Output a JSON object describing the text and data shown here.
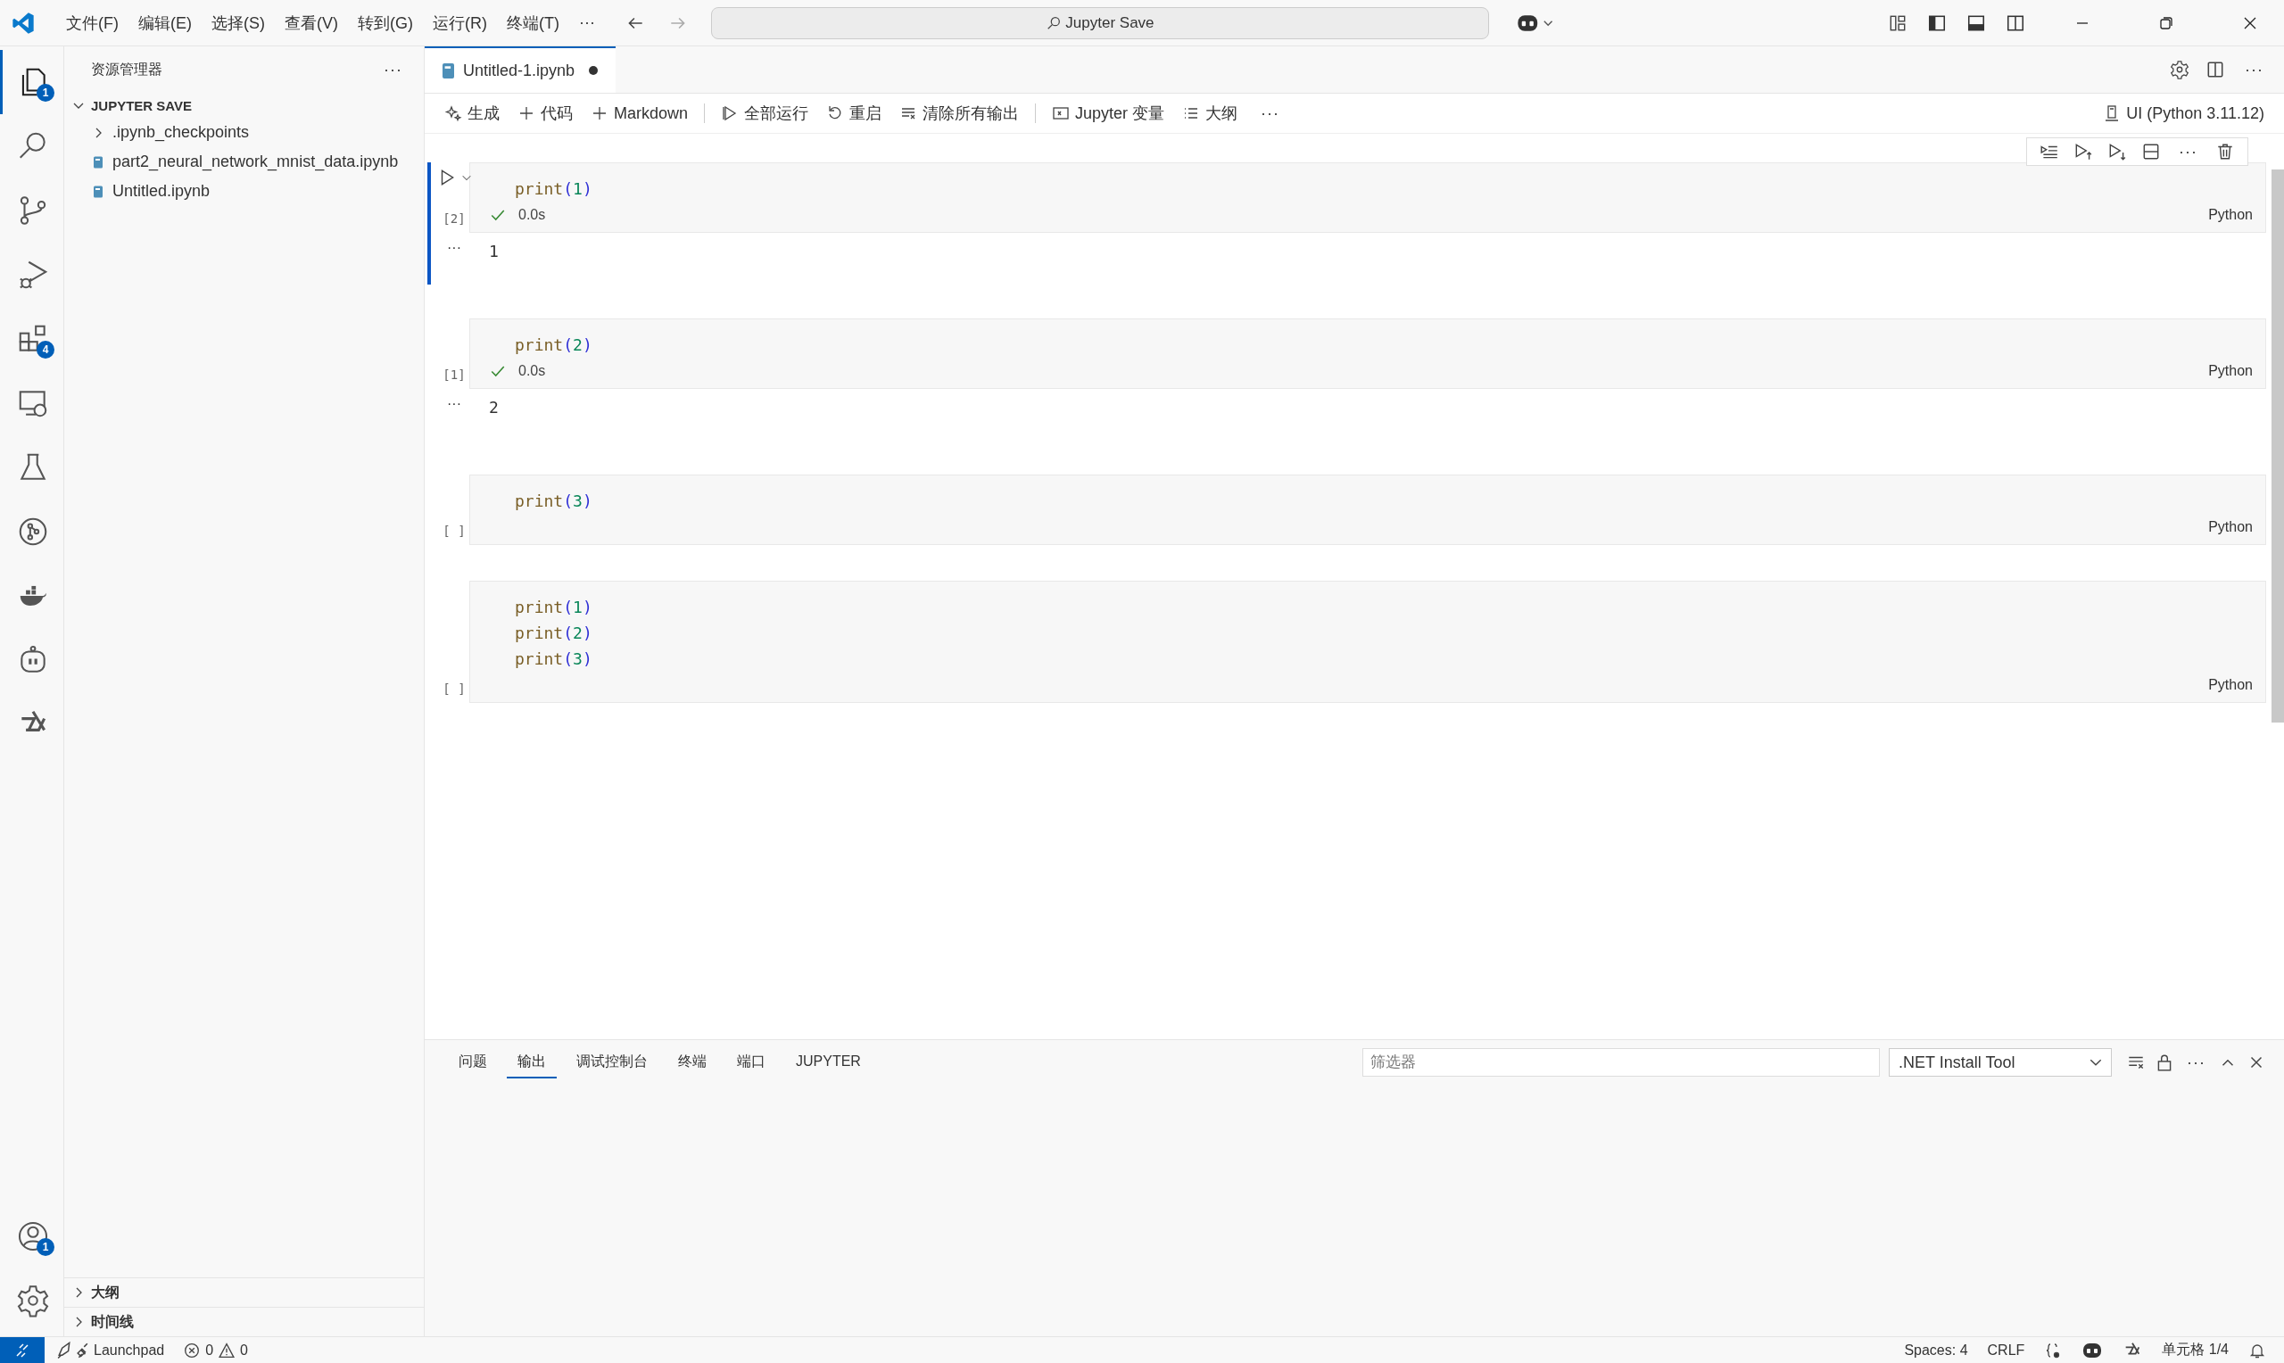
{
  "title_bar": {
    "menus": [
      "文件(F)",
      "编辑(E)",
      "选择(S)",
      "查看(V)",
      "转到(G)",
      "运行(R)",
      "终端(T)"
    ],
    "more": "···",
    "search": "Jupyter Save"
  },
  "activity_bar": {
    "top": [
      {
        "kind": "explorer",
        "selected": true,
        "badge": "1"
      },
      {
        "kind": "search",
        "selected": false
      },
      {
        "kind": "source-control",
        "selected": false
      },
      {
        "kind": "run-debug",
        "selected": false
      },
      {
        "kind": "extensions",
        "selected": false,
        "badge": "4"
      },
      {
        "kind": "remote",
        "selected": false
      },
      {
        "kind": "flask",
        "selected": false
      },
      {
        "kind": "git-graph",
        "selected": false
      },
      {
        "kind": "whale",
        "selected": false
      },
      {
        "kind": "robot",
        "selected": false
      },
      {
        "kind": "knot",
        "selected": false
      }
    ],
    "bottom": [
      {
        "kind": "account",
        "selected": false,
        "badge": "1"
      },
      {
        "kind": "gear",
        "selected": false
      }
    ]
  },
  "sidebar": {
    "title": "资源管理器",
    "more": "···",
    "folder": {
      "name": "JUPYTER SAVE",
      "expanded": true
    },
    "items": [
      {
        "name": ".ipynb_checkpoints",
        "kind": "folder",
        "expanded": false
      },
      {
        "name": "part2_neural_network_mnist_data.ipynb",
        "kind": "notebook"
      },
      {
        "name": "Untitled.ipynb",
        "kind": "notebook"
      }
    ],
    "sections": [
      {
        "name": "大纲",
        "expanded": false
      },
      {
        "name": "时间线",
        "expanded": false
      }
    ]
  },
  "editor_tab": {
    "title": "Untitled-1.ipynb",
    "dirty": true,
    "selected": true
  },
  "toolbar": {
    "groups": [
      [
        {
          "label": "生成",
          "kind": "sparkle"
        },
        {
          "label": "代码",
          "kind": "plus"
        },
        {
          "label": "Markdown",
          "kind": "plus"
        }
      ],
      [
        {
          "label": "全部运行",
          "kind": "run"
        },
        {
          "label": "重启",
          "kind": "restart"
        },
        {
          "label": "清除所有输出",
          "kind": "clear"
        }
      ],
      [
        {
          "label": "Jupyter 变量",
          "kind": "variables"
        },
        {
          "label": "大纲",
          "kind": "list"
        }
      ]
    ],
    "more": "···",
    "kernel": "UI (Python 3.11.12)"
  },
  "cells": [
    {
      "count": "[2]",
      "selected": true,
      "lines": [
        [
          {
            "text": "print",
            "kind": "function"
          },
          {
            "text": "(",
            "kind": "paren"
          },
          {
            "text": "1",
            "kind": "number"
          },
          {
            "text": ")",
            "kind": "paren"
          }
        ]
      ],
      "status": {
        "kind": "success",
        "time": "0.0s"
      },
      "output": "1",
      "output_more": "···",
      "language": "Python"
    },
    {
      "count": "[1]",
      "selected": false,
      "lines": [
        [
          {
            "text": "print",
            "kind": "function"
          },
          {
            "text": "(",
            "kind": "paren"
          },
          {
            "text": "2",
            "kind": "number"
          },
          {
            "text": ")",
            "kind": "paren"
          }
        ]
      ],
      "status": {
        "kind": "success",
        "time": "0.0s"
      },
      "output": "2",
      "output_more": "···",
      "language": "Python"
    },
    {
      "count": "[ ]",
      "selected": false,
      "lines": [
        [
          {
            "text": "print",
            "kind": "function"
          },
          {
            "text": "(",
            "kind": "paren"
          },
          {
            "text": "3",
            "kind": "number"
          },
          {
            "text": ")",
            "kind": "paren"
          }
        ]
      ],
      "language": "Python"
    },
    {
      "count": "[ ]",
      "selected": false,
      "lines": [
        [
          {
            "text": "print",
            "kind": "function"
          },
          {
            "text": "(",
            "kind": "paren"
          },
          {
            "text": "1",
            "kind": "number"
          },
          {
            "text": ")",
            "kind": "paren"
          }
        ],
        [
          {
            "text": "print",
            "kind": "function"
          },
          {
            "text": "(",
            "kind": "paren"
          },
          {
            "text": "2",
            "kind": "number"
          },
          {
            "text": ")",
            "kind": "paren"
          }
        ],
        [
          {
            "text": "print",
            "kind": "function"
          },
          {
            "text": "(",
            "kind": "paren"
          },
          {
            "text": "3",
            "kind": "number"
          },
          {
            "text": ")",
            "kind": "paren"
          }
        ]
      ],
      "language": "Python"
    }
  ],
  "panel": {
    "tabs": [
      {
        "label": "问题",
        "selected": false
      },
      {
        "label": "输出",
        "selected": true
      },
      {
        "label": "调试控制台",
        "selected": false
      },
      {
        "label": "终端",
        "selected": false
      },
      {
        "label": "端口",
        "selected": false
      },
      {
        "label": "JUPYTER",
        "selected": false
      }
    ],
    "filter_placeholder": "筛选器",
    "channel": ".NET Install Tool",
    "more": "···"
  },
  "status_bar": {
    "launchpad": "Launchpad",
    "errors": "0",
    "warnings": "0",
    "spaces": "Spaces: 4",
    "eol": "CRLF",
    "cell": "单元格 1/4"
  }
}
